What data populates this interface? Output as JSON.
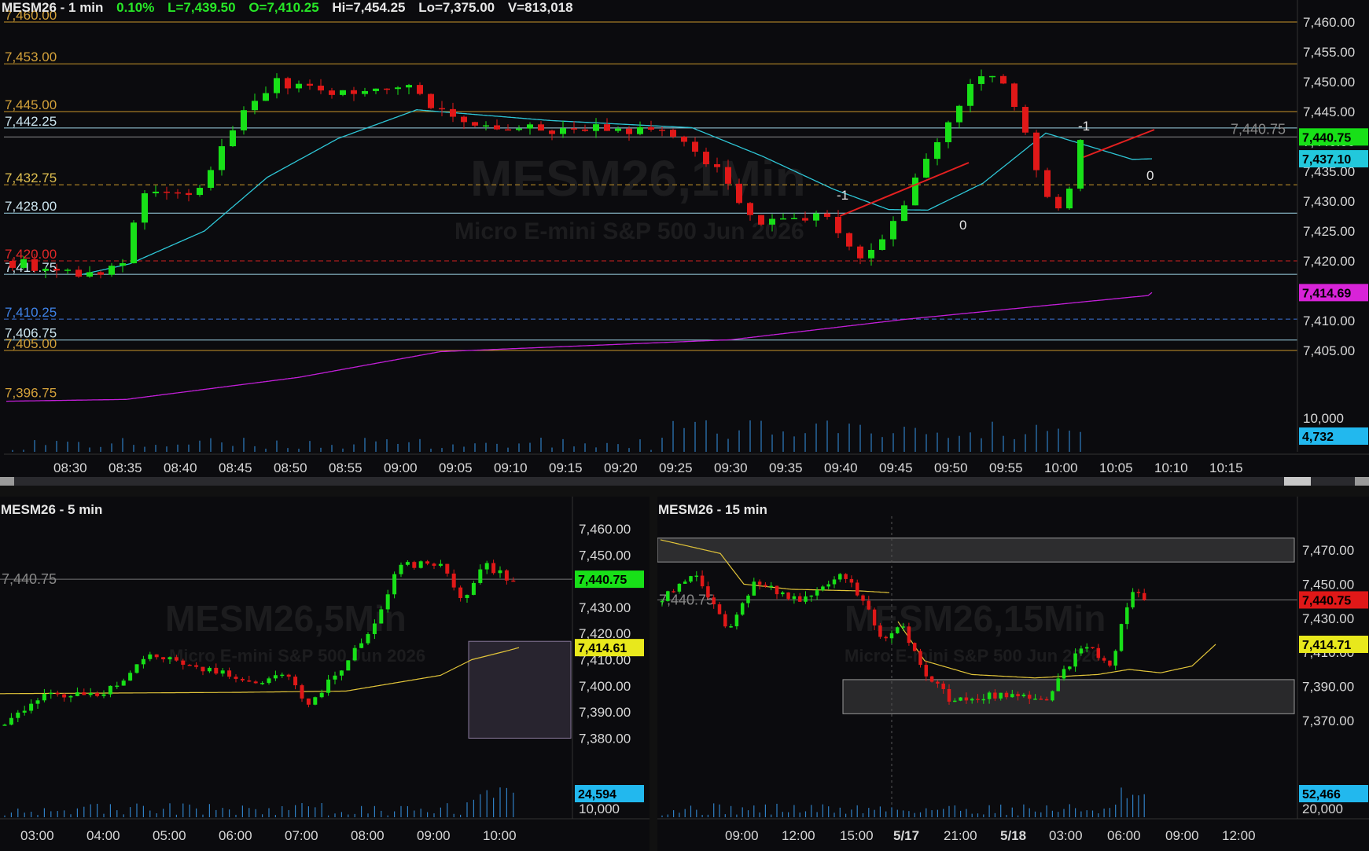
{
  "colors": {
    "up": "#18e018",
    "down": "#e01818",
    "ema": "#2ec6d6",
    "sma": "#c21fd8",
    "avg5": "#e2c53a",
    "level_gold": "#c8962a",
    "level_blue": "#3c74d8",
    "level_cyan": "#9fd6e8",
    "level_red": "#d02020"
  },
  "main": {
    "header": {
      "symbol": "MESM26 - 1 min",
      "change": "0.10%",
      "last": "L=7,439.50",
      "open": "O=7,410.25",
      "high": "Hi=7,454.25",
      "low": "Lo=7,375.00",
      "volume": "V=813,018"
    },
    "watermark": {
      "title": "MESM26,1Min",
      "subtitle": "Micro E-mini S&P 500 Jun 2026"
    },
    "y_ticks": [
      "7,460.00",
      "7,455.00",
      "7,450.00",
      "7,445.00",
      "7,440.00",
      "7,435.00",
      "7,430.00",
      "7,425.00",
      "7,420.00",
      "7,415.00",
      "7,410.00",
      "7,405.00"
    ],
    "vol_tick": "10,000",
    "x_ticks": [
      "08:30",
      "08:35",
      "08:40",
      "08:45",
      "08:50",
      "08:55",
      "09:00",
      "09:05",
      "09:10",
      "09:15",
      "09:20",
      "09:25",
      "09:30",
      "09:35",
      "09:40",
      "09:45",
      "09:50",
      "09:55",
      "10:00",
      "10:05",
      "10:10",
      "10:15"
    ],
    "levels": [
      {
        "label": "7,460.00",
        "value": 7460,
        "style": "gold"
      },
      {
        "label": "7,453.00",
        "value": 7453,
        "style": "gold"
      },
      {
        "label": "7,445.00",
        "value": 7445,
        "style": "gold"
      },
      {
        "label": "7,442.25",
        "value": 7442.25,
        "style": "cyan"
      },
      {
        "label": "7,432.75",
        "value": 7432.75,
        "style": "golddash"
      },
      {
        "label": "7,428.00",
        "value": 7428,
        "style": "cyan"
      },
      {
        "label": "7,420.00",
        "value": 7420,
        "style": "reddash"
      },
      {
        "label": "7,417.75",
        "value": 7417.75,
        "style": "cyan"
      },
      {
        "label": "7,410.25",
        "value": 7410.25,
        "style": "bluedash"
      },
      {
        "label": "7,406.75",
        "value": 7406.75,
        "style": "cyan"
      },
      {
        "label": "7,405.00",
        "value": 7405,
        "style": "gold"
      },
      {
        "label": "7,396.75",
        "value": 7396.75,
        "style": "none"
      }
    ],
    "last_line_label": "7,440.75",
    "tags": [
      {
        "text": "7,440.75",
        "value": 7440.75,
        "bg": "#18e018",
        "fg": "#000"
      },
      {
        "text": "7,437.10",
        "value": 7437.1,
        "bg": "#22c8dc",
        "fg": "#000"
      },
      {
        "text": "7,414.69",
        "value": 7414.69,
        "bg": "#d823d8",
        "fg": "#000"
      }
    ],
    "vol_tag": "4,732",
    "annotations": [
      "-1",
      "0",
      "-1",
      "0"
    ]
  },
  "bottom_left": {
    "header": "MESM26 - 5 min",
    "watermark": {
      "title": "MESM26,5Min",
      "subtitle": "Micro E-mini S&P 500 Jun 2026"
    },
    "last_line_label": "7,440.75",
    "y_ticks": [
      "7,460.00",
      "7,450.00",
      "7,440.00",
      "7,430.00",
      "7,420.00",
      "7,410.00",
      "7,400.00",
      "7,390.00",
      "7,380.00"
    ],
    "vol_tick": "10,000",
    "tags": [
      {
        "text": "7,440.75",
        "value": 7440.75,
        "bg": "#18e018",
        "fg": "#000"
      },
      {
        "text": "7,414.61",
        "value": 7414.61,
        "bg": "#e8e81c",
        "fg": "#000"
      }
    ],
    "vol_tag": "24,594",
    "x_ticks": [
      "03:00",
      "04:00",
      "05:00",
      "06:00",
      "07:00",
      "08:00",
      "09:00",
      "10:00"
    ]
  },
  "bottom_right": {
    "header": "MESM26 - 15 min",
    "watermark": {
      "title": "MESM26,15Min",
      "subtitle": "Micro E-mini S&P 500 Jun 2026"
    },
    "last_line_label": "7,440.75",
    "y_ticks": [
      "7,470.00",
      "7,450.00",
      "7,430.00",
      "7,410.00",
      "7,390.00",
      "7,370.00"
    ],
    "vol_tick": "20,000",
    "tags": [
      {
        "text": "7,440.75",
        "value": 7440.75,
        "bg": "#e01818",
        "fg": "#000"
      },
      {
        "text": "7,414.71",
        "value": 7414.71,
        "bg": "#e8e81c",
        "fg": "#000"
      }
    ],
    "vol_tag": "52,466",
    "x_ticks": [
      "09:00",
      "12:00",
      "15:00",
      "5/17",
      "21:00",
      "5/18",
      "03:00",
      "06:00",
      "09:00",
      "12:00"
    ]
  }
}
